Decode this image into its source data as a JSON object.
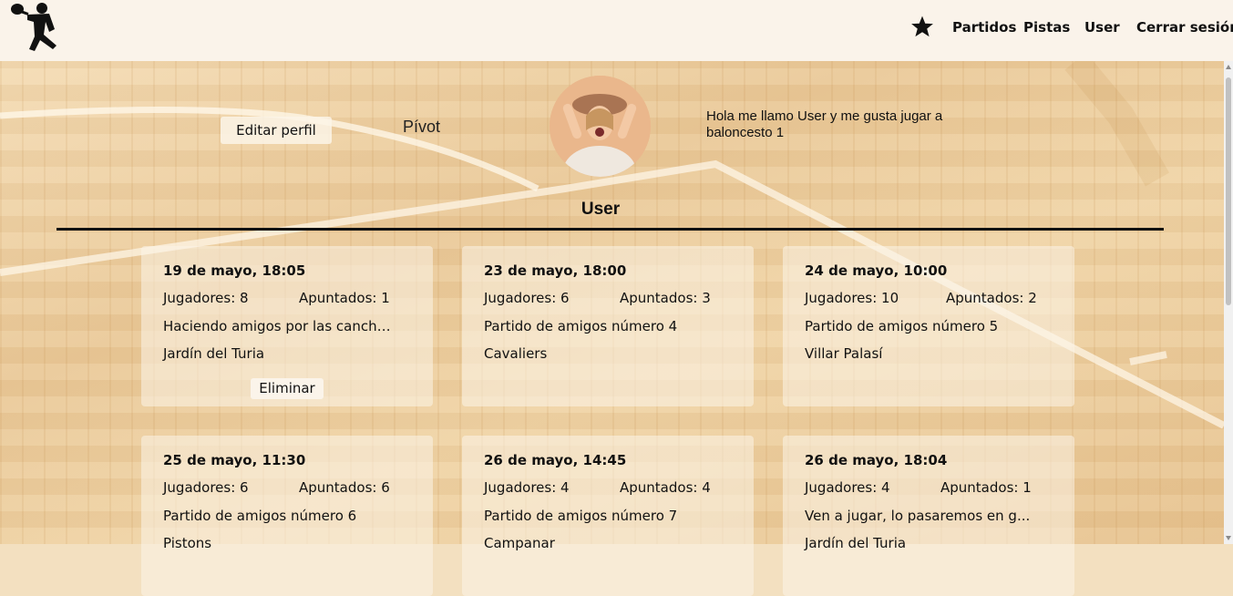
{
  "nav": {
    "logo_icon": "padel-player-silhouette-icon",
    "star_icon": "star-icon",
    "links": [
      "Partidos",
      "Pistas",
      "User",
      "Cerrar sesión"
    ]
  },
  "profile": {
    "edit_label": "Editar perfil",
    "position": "Pívot",
    "avatar_icon": "user-avatar-photo",
    "bio": "Hola me llamo User y me gusta jugar a baloncesto 1",
    "username": "User"
  },
  "matches": [
    {
      "date": "19 de mayo, 18:05",
      "players": "Jugadores: 8",
      "signed": "Apuntados: 1",
      "desc": "Haciendo amigos por las cancha...",
      "place": "Jardín del Turia",
      "delete_label": "Eliminar"
    },
    {
      "date": "23 de mayo, 18:00",
      "players": "Jugadores: 6",
      "signed": "Apuntados: 3",
      "desc": "Partido de amigos número 4",
      "place": "Cavaliers"
    },
    {
      "date": "24 de mayo, 10:00",
      "players": "Jugadores: 10",
      "signed": "Apuntados: 2",
      "desc": "Partido de amigos número 5",
      "place": "Villar Palasí"
    },
    {
      "date": "25 de mayo, 11:30",
      "players": "Jugadores: 6",
      "signed": "Apuntados: 6",
      "desc": "Partido de amigos número 6",
      "place": "Pistons"
    },
    {
      "date": "26 de mayo, 14:45",
      "players": "Jugadores: 4",
      "signed": "Apuntados: 4",
      "desc": "Partido de amigos número 7",
      "place": "Campanar"
    },
    {
      "date": "26 de mayo, 18:04",
      "players": "Jugadores: 4",
      "signed": "Apuntados: 1",
      "desc": "Ven a jugar, lo pasaremos en g...",
      "place": "Jardín del Turia"
    }
  ],
  "colors": {
    "navbar": "#faf3ea",
    "text": "#111111",
    "divider": "#111111"
  }
}
